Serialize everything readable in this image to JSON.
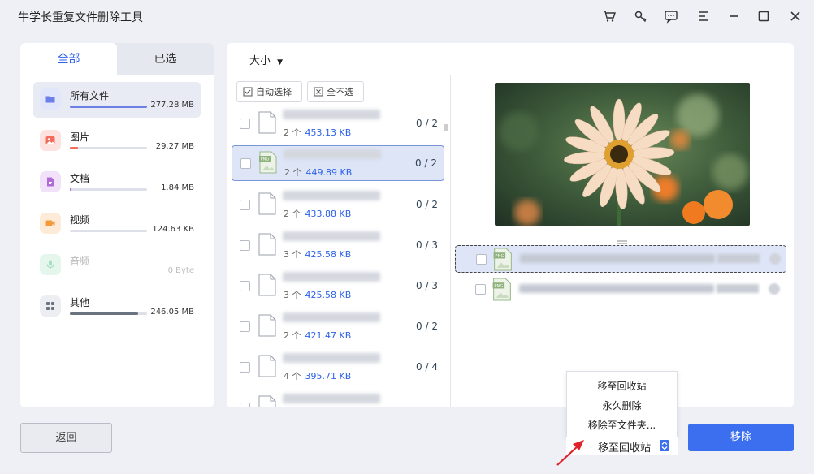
{
  "app": {
    "title": "牛学长重复文件删除工具"
  },
  "titlebar_icons": [
    "cart-icon",
    "key-icon",
    "feedback-icon",
    "menu-icon",
    "minimize-icon",
    "maximize-icon",
    "close-icon"
  ],
  "tabs": [
    {
      "label": "全部"
    },
    {
      "label": "已选"
    }
  ],
  "categories": [
    {
      "name": "所有文件",
      "size": "277.28 MB",
      "icon": "folder-icon",
      "color": "#6d7fe6",
      "fill": 1.0
    },
    {
      "name": "图片",
      "size": "29.27 MB",
      "icon": "image-icon",
      "color": "#f26b5b",
      "fill": 0.1
    },
    {
      "name": "文档",
      "size": "1.84 MB",
      "icon": "document-icon",
      "color": "#b26ad8",
      "fill": 0.01
    },
    {
      "name": "视频",
      "size": "124.63 KB",
      "icon": "video-icon",
      "color": "#f39a3a",
      "fill": 0.0
    },
    {
      "name": "音频",
      "size": "0 Byte",
      "icon": "audio-icon",
      "color": "#5bc38b",
      "fill": 0.0
    },
    {
      "name": "其他",
      "size": "246.05 MB",
      "icon": "other-icon",
      "color": "#6b7280",
      "fill": 0.88
    }
  ],
  "sort": {
    "label": "大小"
  },
  "toolbar": {
    "auto_select": "自动选择",
    "deselect_all": "全不选"
  },
  "files": [
    {
      "count": "2 个",
      "size": "453.13 KB",
      "ratio": "0 / 2",
      "type": "doc"
    },
    {
      "count": "2 个",
      "size": "449.89 KB",
      "ratio": "0 / 2",
      "type": "png",
      "selected": true
    },
    {
      "count": "2 个",
      "size": "433.88 KB",
      "ratio": "0 / 2",
      "type": "doc"
    },
    {
      "count": "3 个",
      "size": "425.58 KB",
      "ratio": "0 / 3",
      "type": "doc"
    },
    {
      "count": "3 个",
      "size": "425.58 KB",
      "ratio": "0 / 3",
      "type": "doc"
    },
    {
      "count": "2 个",
      "size": "421.47 KB",
      "ratio": "0 / 2",
      "type": "doc"
    },
    {
      "count": "4 个",
      "size": "395.71 KB",
      "ratio": "0 / 4",
      "type": "doc"
    },
    {
      "count": "",
      "size": "",
      "ratio": "",
      "type": "doc"
    }
  ],
  "duplicates": [
    {
      "icon": "png-file-icon"
    },
    {
      "icon": "png-file-icon"
    }
  ],
  "menu": {
    "items": [
      "移至回收站",
      "永久删除",
      "移除至文件夹..."
    ]
  },
  "action_select": {
    "value": "移至回收站"
  },
  "buttons": {
    "back": "返回",
    "remove": "移除"
  },
  "colors": {
    "accent": "#3b6ff0",
    "annotation_arrow": "#e0202a"
  }
}
